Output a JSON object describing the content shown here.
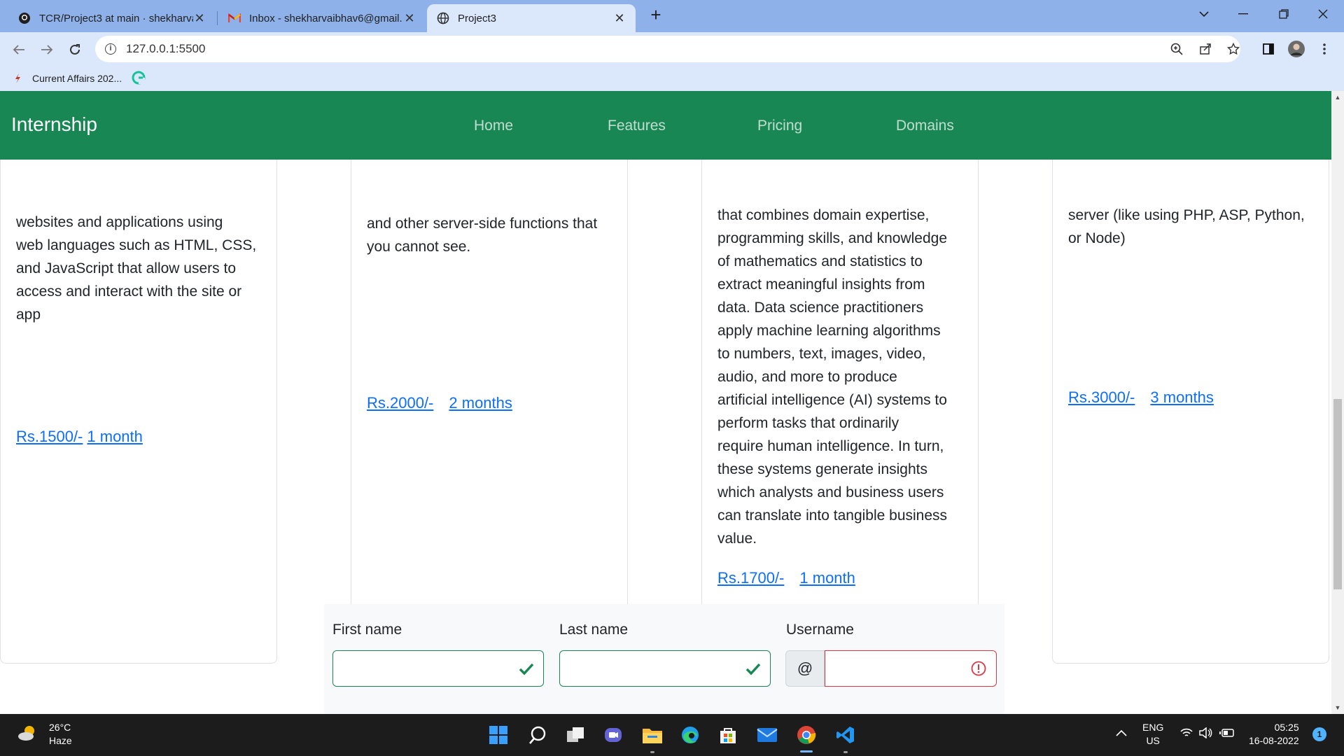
{
  "browser": {
    "tabs": [
      {
        "title": "TCR/Project3 at main · shekharva",
        "icon": "github-icon"
      },
      {
        "title": "Inbox - shekharvaibhav6@gmail.",
        "icon": "gmail-icon"
      },
      {
        "title": "Project3",
        "icon": "globe-icon"
      }
    ],
    "url": "127.0.0.1:5500",
    "bookmarks": [
      {
        "label": "Current Affairs 202...",
        "icon": "bookmark-favicon"
      },
      {
        "label": "",
        "icon": "grammarly-icon"
      }
    ]
  },
  "nav": {
    "brand": "Internship",
    "links": [
      "Home",
      "Features",
      "Pricing",
      "Domains"
    ]
  },
  "cards": [
    {
      "lines": [
        "websites and applications using",
        "web languages such as HTML, CSS,",
        "and JavaScript that allow users to",
        "access and interact with the site or",
        "app"
      ],
      "price": "Rs.1500/-",
      "duration": "1 month"
    },
    {
      "lines": [
        "and other server-side functions that",
        "you cannot see."
      ],
      "price": "Rs.2000/-",
      "duration": "2 months"
    },
    {
      "lines": [
        "that combines domain expertise,",
        "programming skills, and knowledge",
        "of mathematics and statistics to",
        "extract meaningful insights from",
        "data. Data science practitioners",
        "apply machine learning algorithms",
        "to numbers, text, images, video,",
        "audio, and more to produce",
        "artificial intelligence (AI) systems to",
        "perform tasks that ordinarily",
        "require human intelligence. In turn,",
        "these systems generate insights",
        "which analysts and business users",
        "can translate into tangible business",
        "value."
      ],
      "price": "Rs.1700/-",
      "duration": "1 month"
    },
    {
      "lines": [
        "server (like using PHP, ASP, Python,",
        "or Node)"
      ],
      "price": "Rs.3000/-",
      "duration": "3 months"
    }
  ],
  "form": {
    "first_name_label": "First name",
    "last_name_label": "Last name",
    "username_label": "Username",
    "username_prefix": "@",
    "first_name_value": "",
    "last_name_value": "",
    "username_value": ""
  },
  "taskbar": {
    "weather_temp": "26°C",
    "weather_desc": "Haze",
    "lang_top": "ENG",
    "lang_bottom": "US",
    "time": "05:25",
    "date": "16-08-2022",
    "notification_count": "1"
  }
}
